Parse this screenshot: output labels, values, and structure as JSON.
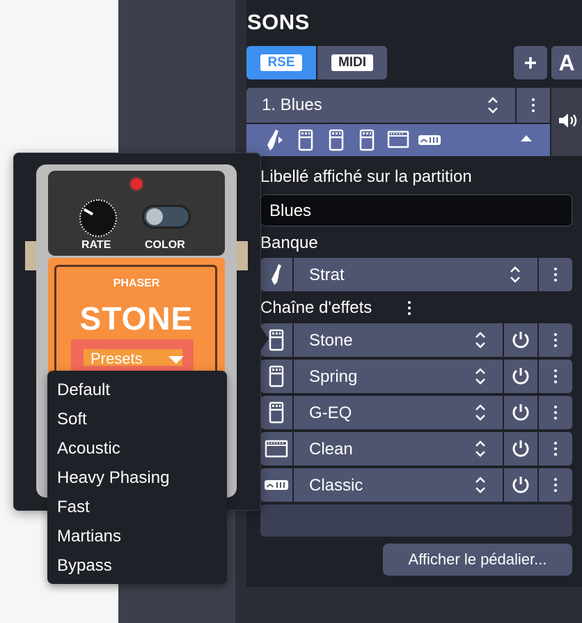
{
  "panel": {
    "title": "SONS",
    "tabs": {
      "rse": "RSE",
      "midi": "MIDI"
    },
    "add_label": "+",
    "auto_label": "A"
  },
  "track": {
    "name": "1. Blues"
  },
  "label_section": {
    "heading": "Libellé affiché sur la partition",
    "value": "Blues"
  },
  "bank": {
    "heading": "Banque",
    "value": "Strat"
  },
  "effects": {
    "heading": "Chaîne d'effets",
    "chain": [
      {
        "name": "Stone",
        "icon": "pedal-icon"
      },
      {
        "name": "Spring",
        "icon": "pedal-icon"
      },
      {
        "name": "G-EQ",
        "icon": "pedal-icon"
      },
      {
        "name": "Clean",
        "icon": "amp-icon"
      },
      {
        "name": "Classic",
        "icon": "rack-icon"
      }
    ]
  },
  "pedalboard_button": "Afficher le pédalier...",
  "pedal": {
    "rate_label": "RATE",
    "color_label": "COLOR",
    "type_label": "PHASER",
    "name": "STONE",
    "presets_label": "Presets",
    "body_color": "#f7903f",
    "led_color": "#e8272f"
  },
  "presets_menu": [
    "Default",
    "Soft",
    "Acoustic",
    "Heavy Phasing",
    "Fast",
    "Martians",
    "Bypass"
  ],
  "colors": {
    "accent": "#3d8ff0",
    "row": "#4f5570",
    "effects_bar": "#5b6aa3"
  }
}
